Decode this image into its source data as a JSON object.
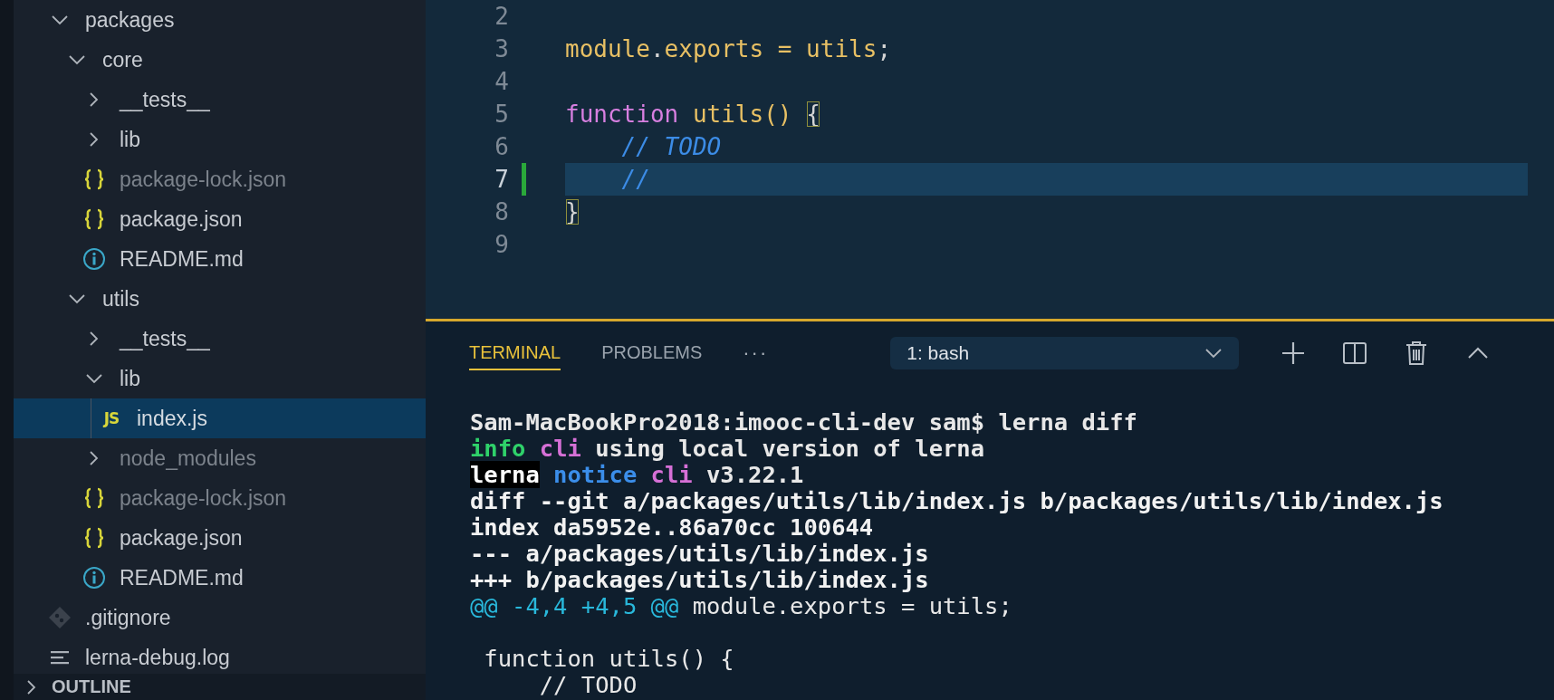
{
  "sidebar": {
    "tree": [
      {
        "name": "packages",
        "kind": "folder",
        "expanded": true,
        "selected": false,
        "dimmed": false,
        "children": [
          {
            "name": "core",
            "kind": "folder",
            "expanded": true,
            "selected": false,
            "dimmed": false,
            "children": [
              {
                "name": "__tests__",
                "kind": "folder",
                "expanded": false,
                "selected": false,
                "dimmed": false
              },
              {
                "name": "lib",
                "kind": "folder",
                "expanded": false,
                "selected": false,
                "dimmed": false
              },
              {
                "name": "package-lock.json",
                "kind": "json",
                "selected": false,
                "dimmed": true
              },
              {
                "name": "package.json",
                "kind": "json",
                "selected": false,
                "dimmed": false
              },
              {
                "name": "README.md",
                "kind": "info",
                "selected": false,
                "dimmed": false
              }
            ]
          },
          {
            "name": "utils",
            "kind": "folder",
            "expanded": true,
            "selected": false,
            "dimmed": false,
            "children": [
              {
                "name": "__tests__",
                "kind": "folder",
                "expanded": false,
                "selected": false,
                "dimmed": false
              },
              {
                "name": "lib",
                "kind": "folder",
                "expanded": true,
                "selected": false,
                "dimmed": false,
                "children": [
                  {
                    "name": "index.js",
                    "kind": "js",
                    "badge": "JS",
                    "selected": true,
                    "dimmed": false
                  }
                ]
              },
              {
                "name": "node_modules",
                "kind": "folder",
                "expanded": false,
                "selected": false,
                "dimmed": true
              },
              {
                "name": "package-lock.json",
                "kind": "json",
                "selected": false,
                "dimmed": true
              },
              {
                "name": "package.json",
                "kind": "json",
                "selected": false,
                "dimmed": false
              },
              {
                "name": "README.md",
                "kind": "info",
                "selected": false,
                "dimmed": false
              }
            ]
          }
        ]
      },
      {
        "name": ".gitignore",
        "kind": "git",
        "selected": false,
        "dimmed": false
      },
      {
        "name": "lerna-debug.log",
        "kind": "log",
        "selected": false,
        "dimmed": false
      }
    ],
    "outline": {
      "label": "OUTLINE",
      "expanded": false
    }
  },
  "editor": {
    "lines": [
      {
        "number": "2",
        "current": false,
        "modified": false
      },
      {
        "number": "3",
        "current": false,
        "modified": false,
        "tokens": [
          {
            "text": "module",
            "color": "#e8c064",
            "kind": "code"
          },
          {
            "text": ".",
            "color": "#d4d4d4",
            "kind": "code"
          },
          {
            "text": "exports = utils",
            "color": "#e8c064",
            "kind": "code"
          },
          {
            "text": ";",
            "color": "#d4d4d4",
            "kind": "code"
          }
        ]
      },
      {
        "number": "4",
        "current": false,
        "modified": false
      },
      {
        "number": "5",
        "current": false,
        "modified": false,
        "tokens": [
          {
            "text": "function",
            "color": "#d77fe0",
            "kind": "code"
          },
          {
            "text": " utils() ",
            "color": "#e8c064",
            "kind": "code"
          },
          {
            "text": "{",
            "color": "#d4d4d4",
            "kind": "bracket"
          }
        ]
      },
      {
        "number": "6",
        "current": false,
        "modified": false,
        "tokens": [
          {
            "text": "    // TODO",
            "color": "#3c8ce6",
            "kind": "comment"
          }
        ]
      },
      {
        "number": "7",
        "current": true,
        "modified": true,
        "tokens": [
          {
            "text": "    //",
            "color": "#3c8ce6",
            "kind": "comment"
          }
        ]
      },
      {
        "number": "8",
        "current": false,
        "modified": false,
        "tokens": [
          {
            "text": "}",
            "color": "#d4d4d4",
            "kind": "bracket"
          }
        ]
      },
      {
        "number": "9",
        "current": false,
        "modified": false
      }
    ]
  },
  "terminal": {
    "tabs": [
      {
        "label": "TERMINAL",
        "selected": true
      },
      {
        "label": "PROBLEMS",
        "selected": false
      }
    ],
    "more": "···",
    "shell": "1: bash",
    "lines": [
      {
        "kind": "text",
        "segments": [
          {
            "text": "Sam-MacBookPro2018:imooc-cli-dev sam$ lerna diff",
            "color": "#e8e8e8",
            "kind": "bold"
          }
        ]
      },
      {
        "kind": "text",
        "segments": [
          {
            "text": "info",
            "color": "#2fd26a",
            "kind": "bold"
          },
          {
            "text": " cli",
            "color": "#d670d6",
            "kind": "bold"
          },
          {
            "text": " using local version of lerna",
            "color": "#e8e8e8",
            "kind": "bold"
          }
        ]
      },
      {
        "kind": "text",
        "segments": [
          {
            "text": "lerna",
            "kind": "inverse"
          },
          {
            "text": " notice",
            "color": "#3b8eea",
            "kind": "bold"
          },
          {
            "text": " cli",
            "color": "#d670d6",
            "kind": "bold"
          },
          {
            "text": " v3.22.1",
            "color": "#e8e8e8",
            "kind": "bold"
          }
        ]
      },
      {
        "kind": "text",
        "segments": [
          {
            "text": "diff --git a/packages/utils/lib/index.js b/packages/utils/lib/index.js",
            "color": "#f2f2f2",
            "kind": "bold"
          }
        ]
      },
      {
        "kind": "text",
        "segments": [
          {
            "text": "index da5952e..86a70cc 100644",
            "color": "#f2f2f2",
            "kind": "bold"
          }
        ]
      },
      {
        "kind": "text",
        "segments": [
          {
            "text": "--- a/packages/utils/lib/index.js",
            "color": "#f2f2f2",
            "kind": "bold"
          }
        ]
      },
      {
        "kind": "text",
        "segments": [
          {
            "text": "+++ b/packages/utils/lib/index.js",
            "color": "#f2f2f2",
            "kind": "bold"
          }
        ]
      },
      {
        "kind": "text",
        "segments": [
          {
            "text": "@@ -4,4 +4,5 @@",
            "color": "#29b8db",
            "kind": "plain"
          },
          {
            "text": " module.exports = utils;",
            "color": "#e8e8e8",
            "kind": "plain"
          }
        ]
      },
      {
        "kind": "blank"
      },
      {
        "kind": "text",
        "segments": [
          {
            "text": " function utils() {",
            "color": "#e8e8e8",
            "kind": "plain"
          }
        ]
      },
      {
        "kind": "text",
        "segments": [
          {
            "text": "     // TODO",
            "color": "#e8e8e8",
            "kind": "plain"
          }
        ]
      }
    ]
  }
}
